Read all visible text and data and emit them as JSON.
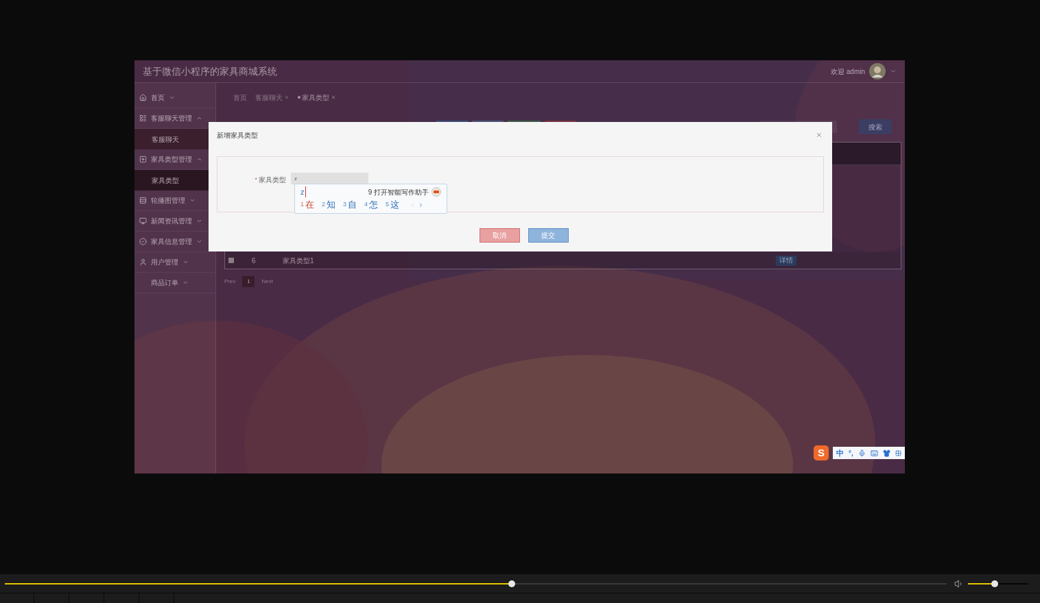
{
  "app": {
    "title": "基于微信小程序的家具商城系统",
    "greeting": "欢迎 admin"
  },
  "sidebar": {
    "items": [
      {
        "label": "首页",
        "expanded": false
      },
      {
        "label": "客服聊天管理",
        "expanded": true,
        "children": [
          {
            "label": "客服聊天",
            "selected": false
          }
        ]
      },
      {
        "label": "家具类型管理",
        "expanded": true,
        "children": [
          {
            "label": "家具类型",
            "selected": true
          }
        ]
      },
      {
        "label": "轮播图管理",
        "expanded": false
      },
      {
        "label": "新闻资讯管理",
        "expanded": false
      },
      {
        "label": "家具信息管理",
        "expanded": false
      },
      {
        "label": "用户管理",
        "expanded": false
      },
      {
        "label": "商品订单",
        "expanded": false
      }
    ]
  },
  "breadcrumb": [
    {
      "label": "首页",
      "closable": false,
      "selected": false
    },
    {
      "label": "客服聊天",
      "closable": true,
      "selected": false
    },
    {
      "label": "家具类型",
      "closable": true,
      "selected": true
    }
  ],
  "toolbar": {
    "search_button": "搜索"
  },
  "table": {
    "rows": [
      {
        "checked": false,
        "id": "6",
        "name": "家具类型1",
        "action": "详情"
      }
    ]
  },
  "pagination": {
    "prev": "Prev",
    "pages": [
      {
        "label": "1",
        "selected": true
      }
    ],
    "next": "Next"
  },
  "modal": {
    "title": "新增家具类型",
    "field": {
      "label": "家具类型",
      "required": true,
      "required_mark": "*",
      "value": "z"
    },
    "buttons": [
      {
        "label": "取消",
        "kind": "cancel"
      },
      {
        "label": "提交",
        "kind": "submit"
      }
    ]
  },
  "ime": {
    "composition": "z",
    "assistant": "9 打开智能写作助手",
    "candidates": [
      {
        "index": "1",
        "text": "在",
        "selected": true
      },
      {
        "index": "2",
        "text": "知",
        "selected": false
      },
      {
        "index": "3",
        "text": "自",
        "selected": false
      },
      {
        "index": "4",
        "text": "怎",
        "selected": false
      },
      {
        "index": "5",
        "text": "这",
        "selected": false
      }
    ]
  },
  "ime_toolbar": {
    "logo": "S",
    "mode": "中",
    "punctuation": "°,"
  },
  "player": {
    "progress": {
      "level": 0.538
    },
    "volume": {
      "level": 0.44
    }
  }
}
